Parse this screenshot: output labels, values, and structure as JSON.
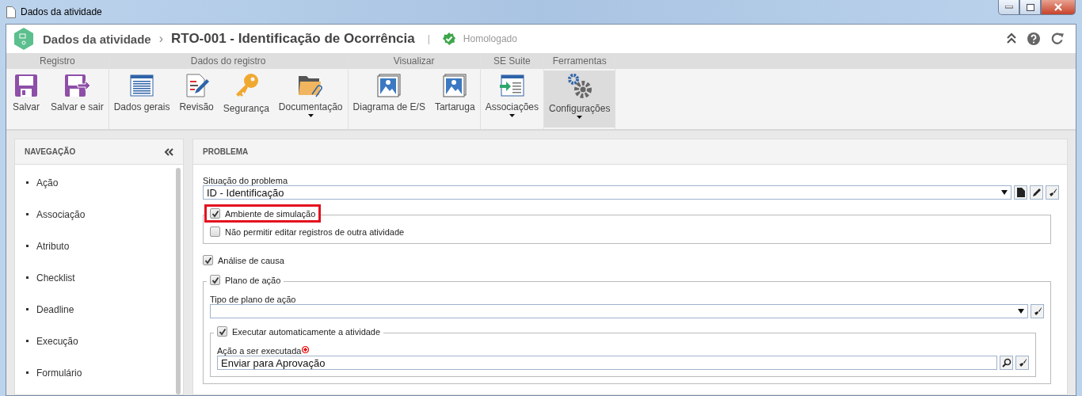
{
  "window": {
    "title": "Dados da atividade"
  },
  "header": {
    "breadcrumb": "Dados da atividade",
    "separator": "›",
    "title": "RTO-001 - Identificação de Ocorrência",
    "divider": "|",
    "status": "Homologado"
  },
  "ribbon": {
    "groups": [
      {
        "label": "Registro",
        "buttons": [
          {
            "label": "Salvar",
            "dropdown": false,
            "selected": false
          },
          {
            "label": "Salvar e sair",
            "dropdown": false,
            "selected": false
          }
        ]
      },
      {
        "label": "Dados do registro",
        "buttons": [
          {
            "label": "Dados gerais",
            "dropdown": false,
            "selected": false
          },
          {
            "label": "Revisão",
            "dropdown": false,
            "selected": false
          },
          {
            "label": "Segurança",
            "dropdown": false,
            "selected": false
          },
          {
            "label": "Documentação",
            "dropdown": true,
            "selected": false
          }
        ]
      },
      {
        "label": "Visualizar",
        "buttons": [
          {
            "label": "Diagrama de E/S",
            "dropdown": false,
            "selected": false
          },
          {
            "label": "Tartaruga",
            "dropdown": false,
            "selected": false
          }
        ]
      },
      {
        "label": "SE Suite",
        "buttons": [
          {
            "label": "Associações",
            "dropdown": true,
            "selected": false
          }
        ]
      },
      {
        "label": "Ferramentas",
        "buttons": [
          {
            "label": "Configurações",
            "dropdown": true,
            "selected": true
          }
        ]
      }
    ]
  },
  "navigation": {
    "title": "NAVEGAÇÃO",
    "items": [
      "Ação",
      "Associação",
      "Atributo",
      "Checklist",
      "Deadline",
      "Execução",
      "Formulário"
    ]
  },
  "panel": {
    "title": "PROBLEMA",
    "situation": {
      "label": "Situação do problema",
      "value": "ID - Identificação"
    },
    "simulation": {
      "label": "Ambiente de simulação",
      "checked": true,
      "highlighted": true,
      "option": {
        "label": "Não permitir editar registros de outra atividade",
        "checked": false
      }
    },
    "cause": {
      "label": "Análise de causa",
      "checked": true
    },
    "plan": {
      "label": "Plano de ação",
      "checked": true,
      "type_label": "Tipo de plano de ação",
      "auto": {
        "label": "Executar automaticamente a atividade",
        "checked": true,
        "action_label": "Ação a ser executada",
        "required": true,
        "action_value": "Enviar para Aprovação"
      }
    }
  }
}
